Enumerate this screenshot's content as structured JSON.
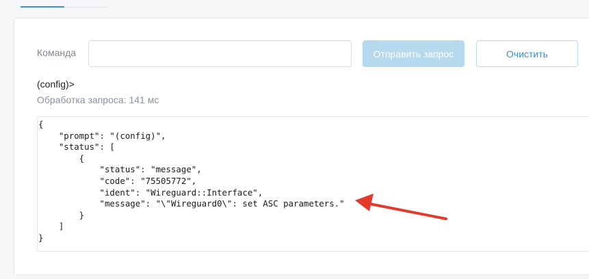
{
  "form": {
    "command_label": "Команда",
    "command_value": "",
    "command_placeholder": "",
    "send_label": "Отправить запрос",
    "clear_label": "Очистить"
  },
  "result": {
    "prompt": "(config)>",
    "timing_prefix": "Обработка запроса:",
    "timing_value": "141",
    "timing_unit": "мс",
    "output_text": "{\n    \"prompt\": \"(config)\",\n    \"status\": [\n        {\n            \"status\": \"message\",\n            \"code\": \"75505772\",\n            \"ident\": \"Wireguard::Interface\",\n            \"message\": \"\\\"Wireguard0\\\": set ASC parameters.\"\n        }\n    ]\n}"
  },
  "colors": {
    "accent": "#3a8fd6",
    "send_button_disabled": "#b7d9ee",
    "annotation_arrow": "#e23b2e"
  }
}
